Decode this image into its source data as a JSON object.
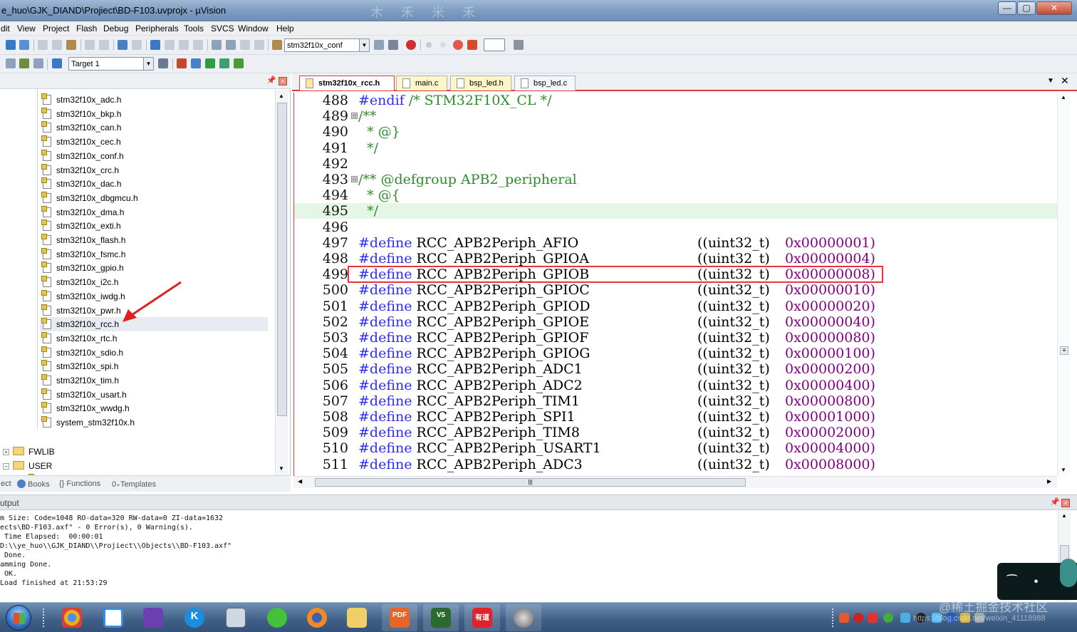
{
  "window": {
    "title": "e_huo\\GJK_DIAND\\Projiect\\BD-F103.uvprojx - µVision",
    "controls": {
      "minimize": "—",
      "maximize": "▢",
      "close": "✕"
    }
  },
  "menu": [
    "dit",
    "View",
    "Project",
    "Flash",
    "Debug",
    "Peripherals",
    "Tools",
    "SVCS",
    "Window",
    "Help"
  ],
  "toolbar1": {
    "find_combo": "stm32f10x_conf"
  },
  "toolbar2": {
    "target_combo": "Target 1"
  },
  "project": {
    "files": [
      "stm32f10x_adc.h",
      "stm32f10x_bkp.h",
      "stm32f10x_can.h",
      "stm32f10x_cec.h",
      "stm32f10x_conf.h",
      "stm32f10x_crc.h",
      "stm32f10x_dac.h",
      "stm32f10x_dbgmcu.h",
      "stm32f10x_dma.h",
      "stm32f10x_exti.h",
      "stm32f10x_flash.h",
      "stm32f10x_fsmc.h",
      "stm32f10x_gpio.h",
      "stm32f10x_i2c.h",
      "stm32f10x_iwdg.h",
      "stm32f10x_pwr.h",
      "stm32f10x_rcc.h",
      "stm32f10x_rtc.h",
      "stm32f10x_sdio.h",
      "stm32f10x_spi.h",
      "stm32f10x_tim.h",
      "stm32f10x_usart.h",
      "stm32f10x_wwdg.h",
      "system_stm32f10x.h"
    ],
    "groups": [
      "FWLIB",
      "USER"
    ],
    "user_files": [
      "main.c"
    ],
    "tabs": [
      "ect",
      "Books",
      "Functions",
      "Templates"
    ]
  },
  "editor": {
    "tabs": [
      "stm32f10x_rcc.h",
      "main.c",
      "bsp_led.h",
      "bsp_led.c"
    ],
    "lines": [
      {
        "n": "488",
        "a": "#endif",
        "b": " /* STM32F10X_CL */",
        "c": "",
        "d": "",
        "fold": ""
      },
      {
        "n": "489",
        "a": "",
        "b": "/**",
        "c": "",
        "d": "",
        "fold": "⊟"
      },
      {
        "n": "490",
        "a": "",
        "b": "  * @}",
        "c": "",
        "d": "",
        "fold": ""
      },
      {
        "n": "491",
        "a": "",
        "b": "  */",
        "c": "",
        "d": "",
        "fold": ""
      },
      {
        "n": "492",
        "a": "",
        "b": "",
        "c": "",
        "d": "",
        "fold": ""
      },
      {
        "n": "493",
        "a": "",
        "b": "/** @defgroup APB2_peripheral",
        "c": "",
        "d": "",
        "fold": "⊟"
      },
      {
        "n": "494",
        "a": "",
        "b": "  * @{",
        "c": "",
        "d": "",
        "fold": ""
      },
      {
        "n": "495",
        "a": "",
        "b": "  */",
        "c": "",
        "d": "",
        "fold": ""
      },
      {
        "n": "496",
        "a": "",
        "b": "",
        "c": "",
        "d": "",
        "fold": ""
      },
      {
        "n": "497",
        "a": "#define",
        "b": " RCC_APB2Periph_AFIO",
        "c": "((uint32_t)",
        "d": "0x00000001)",
        "fold": ""
      },
      {
        "n": "498",
        "a": "#define",
        "b": " RCC_APB2Periph_GPIOA",
        "c": "((uint32_t)",
        "d": "0x00000004)",
        "fold": ""
      },
      {
        "n": "499",
        "a": "#define",
        "b": " RCC_APB2Periph_GPIOB",
        "c": "((uint32_t)",
        "d": "0x00000008)",
        "fold": ""
      },
      {
        "n": "500",
        "a": "#define",
        "b": " RCC_APB2Periph_GPIOC",
        "c": "((uint32_t)",
        "d": "0x00000010)",
        "fold": ""
      },
      {
        "n": "501",
        "a": "#define",
        "b": " RCC_APB2Periph_GPIOD",
        "c": "((uint32_t)",
        "d": "0x00000020)",
        "fold": ""
      },
      {
        "n": "502",
        "a": "#define",
        "b": " RCC_APB2Periph_GPIOE",
        "c": "((uint32_t)",
        "d": "0x00000040)",
        "fold": ""
      },
      {
        "n": "503",
        "a": "#define",
        "b": " RCC_APB2Periph_GPIOF",
        "c": "((uint32_t)",
        "d": "0x00000080)",
        "fold": ""
      },
      {
        "n": "504",
        "a": "#define",
        "b": " RCC_APB2Periph_GPIOG",
        "c": "((uint32_t)",
        "d": "0x00000100)",
        "fold": ""
      },
      {
        "n": "505",
        "a": "#define",
        "b": " RCC_APB2Periph_ADC1",
        "c": "((uint32_t)",
        "d": "0x00000200)",
        "fold": ""
      },
      {
        "n": "506",
        "a": "#define",
        "b": " RCC_APB2Periph_ADC2",
        "c": "((uint32_t)",
        "d": "0x00000400)",
        "fold": ""
      },
      {
        "n": "507",
        "a": "#define",
        "b": " RCC_APB2Periph_TIM1",
        "c": "((uint32_t)",
        "d": "0x00000800)",
        "fold": ""
      },
      {
        "n": "508",
        "a": "#define",
        "b": " RCC_APB2Periph_SPI1",
        "c": "((uint32_t)",
        "d": "0x00001000)",
        "fold": ""
      },
      {
        "n": "509",
        "a": "#define",
        "b": " RCC_APB2Periph_TIM8",
        "c": "((uint32_t)",
        "d": "0x00002000)",
        "fold": ""
      },
      {
        "n": "510",
        "a": "#define",
        "b": " RCC_APB2Periph_USART1",
        "c": "((uint32_t)",
        "d": "0x00004000)",
        "fold": ""
      },
      {
        "n": "511",
        "a": "#define",
        "b": " RCC_APB2Periph_ADC3",
        "c": "((uint32_t)",
        "d": "0x00008000)",
        "fold": ""
      }
    ],
    "highlighted_line": "495",
    "boxed_line": "499"
  },
  "output": {
    "header": "utput",
    "lines": [
      "m Size: Code=1048 RO-data=320 RW-data=0 ZI-data=1632",
      "ects\\BD-F103.axf\" - 0 Error(s), 0 Warning(s).",
      " Time Elapsed:  00:00:01",
      "D:\\\\ye_huo\\\\GJK_DIAND\\\\Projiect\\\\Objects\\\\BD-F103.axf\"",
      " Done.",
      "amming Done.",
      " OK.",
      "Load finished at 21:53:29"
    ]
  },
  "taskbar": {
    "apps": [
      "chrome",
      "baidu-netdisk",
      "visual-studio",
      "kugou",
      "calculator",
      "wechat",
      "firefox",
      "file-explorer",
      "pdf-reader",
      "keil-mdk",
      "youdao",
      "photo"
    ],
    "labels": {
      "pdf": "PDF",
      "youdao": "有道"
    }
  },
  "watermark": {
    "text": "@稀土掘金技术社区",
    "url": "https://blog.csdn.net/weixin_41118988"
  },
  "colors": {
    "accent_red": "#e8343c",
    "keyword_blue": "#2c2cff",
    "comment_green": "#2e8b2e"
  }
}
